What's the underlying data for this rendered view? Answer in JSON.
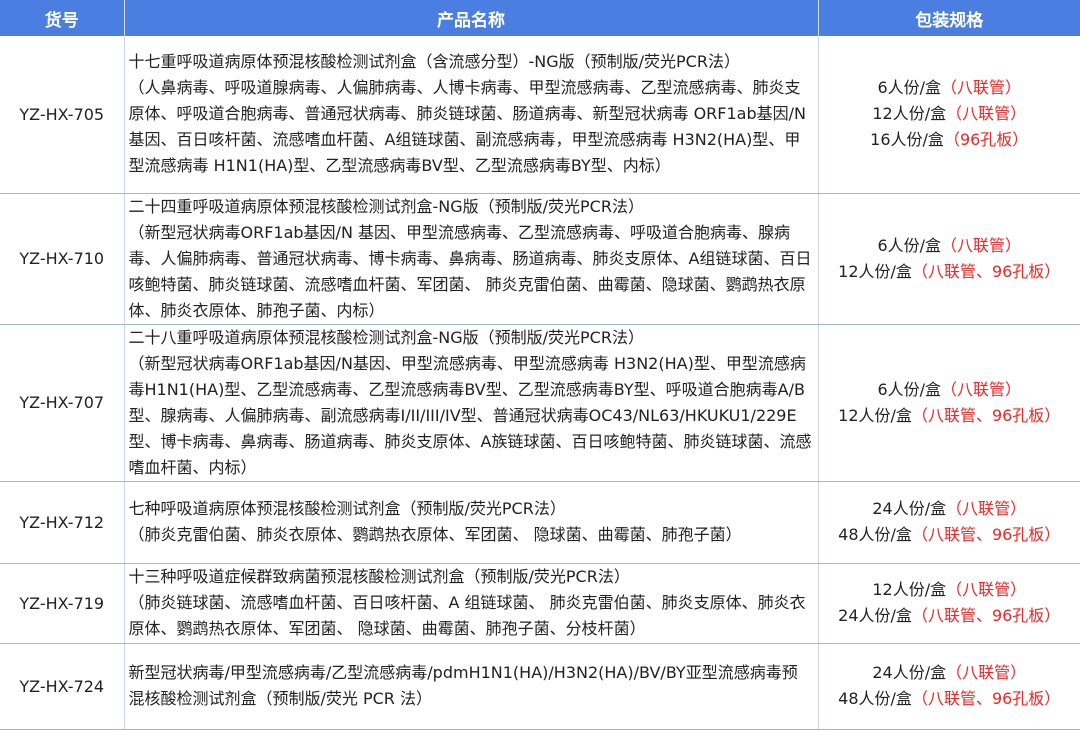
{
  "header": {
    "code": "货号",
    "name": "产品名称",
    "spec": "包装规格"
  },
  "rows": [
    {
      "code": "YZ-HX-705",
      "title": "十七重呼吸道病原体预混核酸检测试剂盒（含流感分型）-NG版（预制版/荧光PCR法）",
      "desc": "（人鼻病毒、呼吸道腺病毒、人偏肺病毒、人博卡病毒、甲型流感病毒、乙型流感病毒、肺炎支原体、呼吸道合胞病毒、普通冠状病毒、肺炎链球菌、肠道病毒、新型冠状病毒 ORF1ab基因/N 基因、百日咳杆菌、流感嗜血杆菌、A组链球菌、副流感病毒，甲型流感病毒 H3N2(HA)型、甲型流感病毒 H1N1(HA)型、乙型流感病毒BV型、乙型流感病毒BY型、内标）",
      "specs": [
        {
          "qty": "6人份/盒",
          "pkg": "（八联管）"
        },
        {
          "qty": "12人份/盒",
          "pkg": "（八联管）"
        },
        {
          "qty": "16人份/盒",
          "pkg": "（96孔板）"
        }
      ]
    },
    {
      "code": "YZ-HX-710",
      "title": "二十四重呼吸道病原体预混核酸检测试剂盒-NG版（预制版/荧光PCR法）",
      "desc": "（新型冠状病毒ORF1ab基因/N 基因、甲型流感病毒、乙型流感病毒、呼吸道合胞病毒、腺病毒、人偏肺病毒、普通冠状病毒、博卡病毒、鼻病毒、肠道病毒、肺炎支原体、A组链球菌、百日咳鲍特菌、肺炎链球菌、流感嗜血杆菌、军团菌、 肺炎克雷伯菌、曲霉菌、隐球菌、鹦鹉热衣原体、肺炎衣原体、肺孢子菌、内标）",
      "specs": [
        {
          "qty": "6人份/盒",
          "pkg": "（八联管）"
        },
        {
          "qty": "12人份/盒",
          "pkg": "（八联管、96孔板）"
        }
      ]
    },
    {
      "code": "YZ-HX-707",
      "title": "二十八重呼吸道病原体预混核酸检测试剂盒-NG版（预制版/荧光PCR法）",
      "desc": "（新型冠状病毒ORF1ab基因/N基因、甲型流感病毒、甲型流感病毒 H3N2(HA)型、甲型流感病毒H1N1(HA)型、乙型流感病毒、乙型流感病毒BV型、乙型流感病毒BY型、呼吸道合胞病毒A/B型、腺病毒、人偏肺病毒、副流感病毒I/II/III/IV型、普通冠状病毒OC43/NL63/HKUKU1/229E型、博卡病毒、鼻病毒、肠道病毒、肺炎支原体、A族链球菌、百日咳鲍特菌、肺炎链球菌、流感嗜血杆菌、内标）",
      "specs": [
        {
          "qty": "6人份/盒",
          "pkg": "（八联管）"
        },
        {
          "qty": "12人份/盒",
          "pkg": "（八联管、96孔板）"
        }
      ]
    },
    {
      "code": "YZ-HX-712",
      "title": "七种呼吸道病原体预混核酸检测试剂盒（预制版/荧光PCR法）",
      "desc": "（肺炎克雷伯菌、肺炎衣原体、鹦鹉热衣原体、军团菌、 隐球菌、曲霉菌、肺孢子菌）",
      "specs": [
        {
          "qty": "24人份/盒",
          "pkg": "（八联管）"
        },
        {
          "qty": "48人份/盒",
          "pkg": "（八联管、96孔板）"
        }
      ]
    },
    {
      "code": "YZ-HX-719",
      "title": "十三种呼吸道症候群致病菌预混核酸检测试剂盒（预制版/荧光PCR法）",
      "desc": "（肺炎链球菌、流感嗜血杆菌、百日咳杆菌、A 组链球菌、 肺炎克雷伯菌、肺炎支原体、肺炎衣原体、鹦鹉热衣原体、军团菌、 隐球菌、曲霉菌、肺孢子菌、分枝杆菌）",
      "specs": [
        {
          "qty": "12人份/盒",
          "pkg": "（八联管）"
        },
        {
          "qty": "24人份/盒",
          "pkg": "（八联管、96孔板）"
        }
      ]
    },
    {
      "code": "YZ-HX-724",
      "title": "新型冠状病毒/甲型流感病毒/乙型流感病毒/pdmH1N1(HA)/H3N2(HA)/BV/BY亚型流感病毒预混核酸检测试剂盒（预制版/荧光 PCR 法）",
      "desc": "",
      "specs": [
        {
          "qty": "24人份/盒",
          "pkg": "（八联管）"
        },
        {
          "qty": "48人份/盒",
          "pkg": "（八联管、96孔板）"
        }
      ]
    }
  ]
}
